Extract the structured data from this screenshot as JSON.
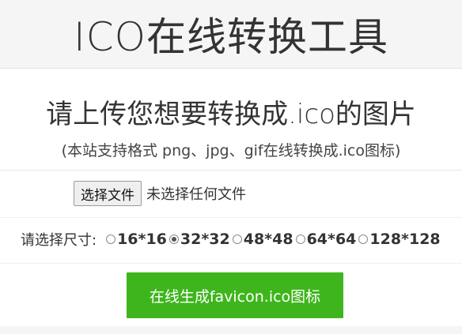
{
  "header": {
    "title": "ICO在线转换工具"
  },
  "main": {
    "title": "请上传您想要转换成.ico的图片",
    "subtitle": "(本站支持格式 png、jpg、gif在线转换成.ico图标)"
  },
  "file_input": {
    "button_label": "选择文件",
    "status_text": "未选择任何文件"
  },
  "size_selector": {
    "label": "请选择尺寸:",
    "options": [
      {
        "label": "16*16",
        "checked": false
      },
      {
        "label": "32*32",
        "checked": true
      },
      {
        "label": "48*48",
        "checked": false
      },
      {
        "label": "64*64",
        "checked": false
      },
      {
        "label": "128*128",
        "checked": false
      }
    ]
  },
  "submit": {
    "label": "在线生成favicon.ico图标"
  },
  "colors": {
    "accent": "#3fb51d",
    "background": "#f5f5f5",
    "panel": "#ffffff"
  }
}
